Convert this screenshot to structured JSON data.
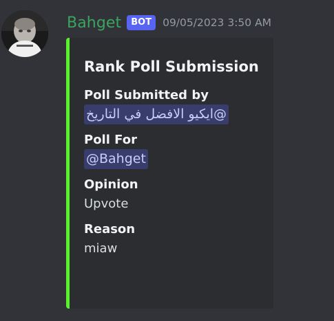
{
  "message": {
    "author": "Bahget",
    "bot_tag": "BOT",
    "timestamp": "09/05/2023 3:50 AM",
    "author_color": "#3ba55d"
  },
  "embed": {
    "accent_color": "#57f22a",
    "title": "Rank Poll Submission",
    "fields": [
      {
        "name": "Poll Submitted by",
        "value": "@ايكيو الافضل في التاريخ",
        "is_mention": true
      },
      {
        "name": "Poll For",
        "value": "@Bahget",
        "is_mention": true
      },
      {
        "name": "Opinion",
        "value": "Upvote",
        "is_mention": false
      },
      {
        "name": "Reason",
        "value": "miaw",
        "is_mention": false
      }
    ]
  }
}
